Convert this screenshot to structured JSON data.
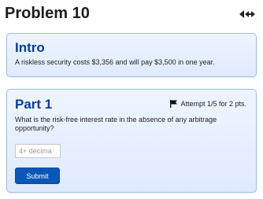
{
  "page": {
    "title": "Problem 10",
    "nav_icon": "prev-next-arrows-icon"
  },
  "intro": {
    "heading": "Intro",
    "text": "A riskless security costs $3,356 and will pay $3,500 in one year."
  },
  "part1": {
    "heading": "Part 1",
    "flag_icon": "flag-icon",
    "attempt": "Attempt 1/5 for 2 pts.",
    "question": "What is the risk-free interest rate in the absence of any arbitrage opportunity?",
    "answer": {
      "value": "",
      "placeholder": "4+ decima"
    },
    "submit_label": "Submit"
  },
  "colors": {
    "heading": "#0a3d91",
    "card_border": "#9cc0ea",
    "button": "#0b57b8"
  }
}
